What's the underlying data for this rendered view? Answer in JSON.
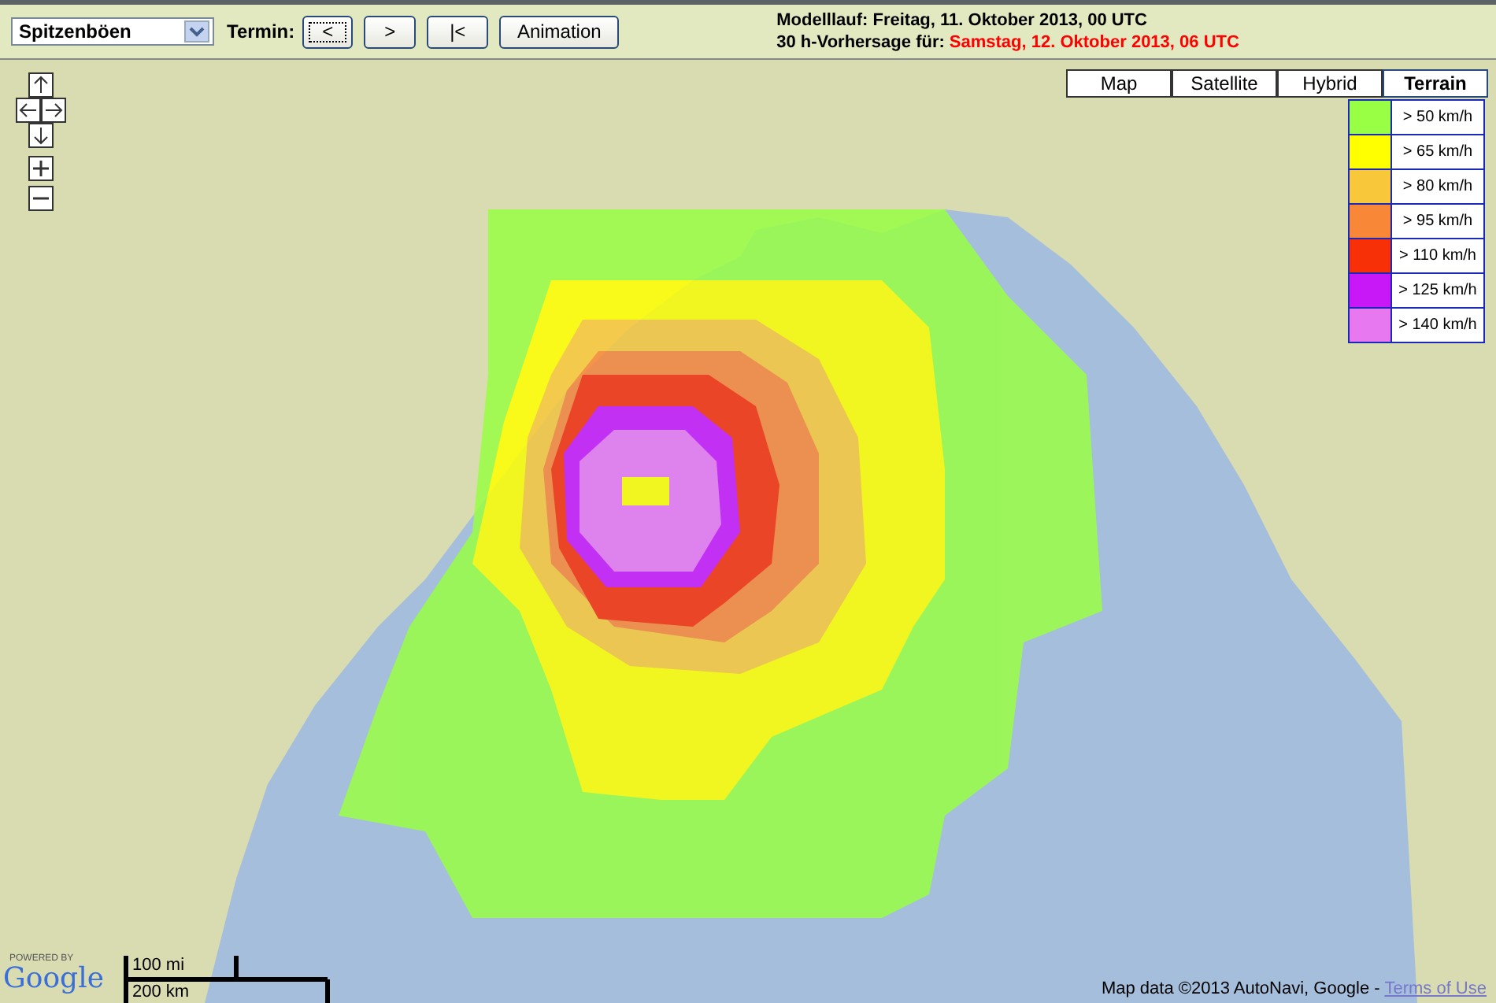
{
  "toolbar": {
    "product_select": {
      "value": "Spitzenböen"
    },
    "termin_label": "Termin:",
    "buttons": [
      {
        "label": "<",
        "selected": true
      },
      {
        "label": ">",
        "selected": false
      },
      {
        "label": "|<",
        "selected": false
      },
      {
        "label": "Animation",
        "selected": false
      }
    ]
  },
  "run_info": {
    "model_run": "Modelllauf: Freitag, 11. Oktober 2013, 00 UTC",
    "forecast_label": "30 h-Vorhersage für:",
    "forecast_time": "Samstag, 12. Oktober 2013, 06 UTC"
  },
  "map": {
    "map_types": [
      {
        "label": "Map",
        "selected": false
      },
      {
        "label": "Satellite",
        "selected": false
      },
      {
        "label": "Hybrid",
        "selected": false
      },
      {
        "label": "Terrain",
        "selected": true
      }
    ],
    "legend": [
      {
        "label": "> 50 km/h",
        "color": "#99ff44"
      },
      {
        "label": "> 65 km/h",
        "color": "#ffff00"
      },
      {
        "label": "> 80 km/h",
        "color": "#f8c83a"
      },
      {
        "label": "> 95 km/h",
        "color": "#f88838"
      },
      {
        "label": "> 110 km/h",
        "color": "#f83008"
      },
      {
        "label": "> 125 km/h",
        "color": "#c818f8"
      },
      {
        "label": "> 140 km/h",
        "color": "#e878f0"
      }
    ],
    "scale": {
      "miles": "100 mi",
      "km": "200 km"
    },
    "logo": {
      "powered_by": "POWERED BY",
      "name": "Google"
    },
    "attribution": {
      "text": "Map data ©2013 AutoNavi, Google - ",
      "link": "Terms of Use"
    }
  }
}
